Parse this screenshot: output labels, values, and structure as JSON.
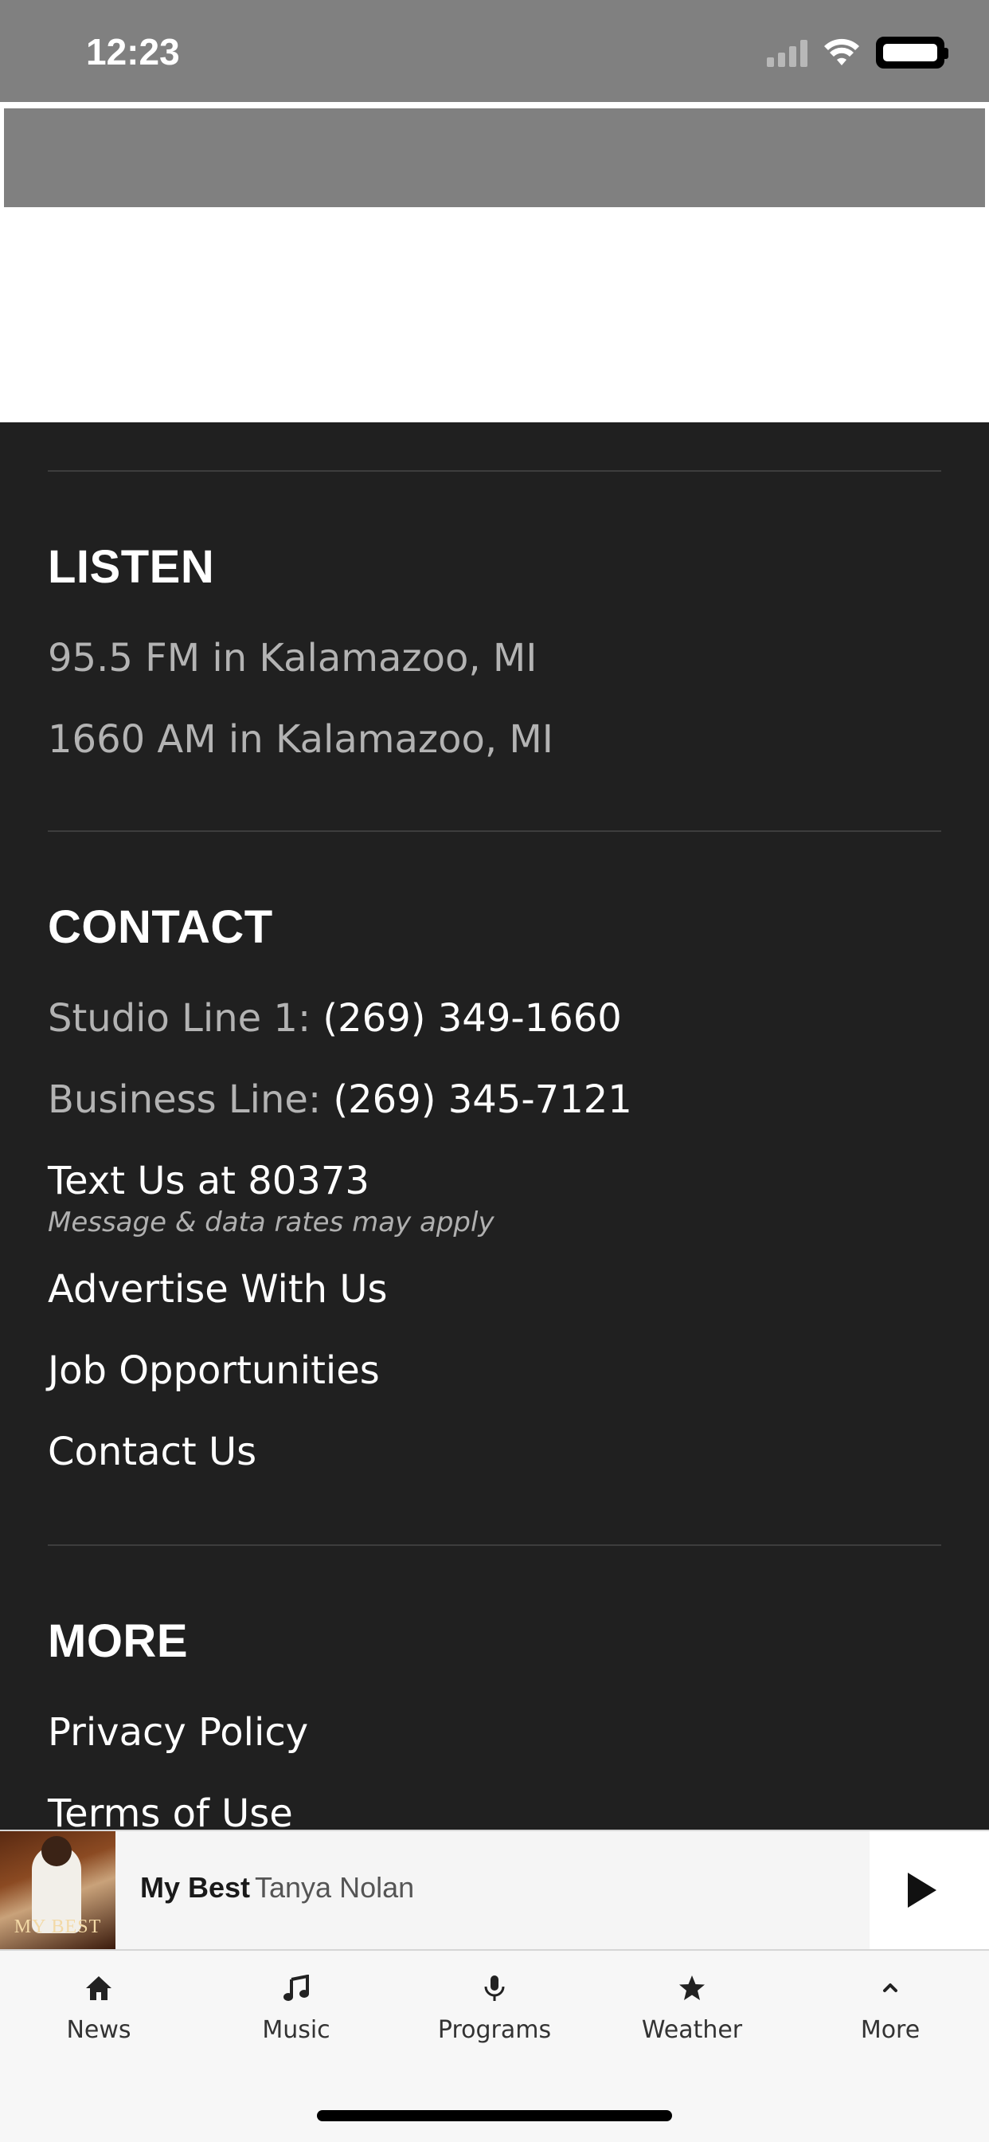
{
  "status_bar": {
    "time": "12:23"
  },
  "footer": {
    "listen": {
      "title": "LISTEN",
      "items": [
        "95.5 FM in Kalamazoo, MI",
        "1660 AM in Kalamazoo, MI"
      ]
    },
    "contact": {
      "title": "CONTACT",
      "studio_label": "Studio Line 1: ",
      "studio_phone": "(269) 349-1660",
      "business_label": "Business Line: ",
      "business_phone": "(269) 345-7121",
      "text_us": "Text Us at 80373",
      "text_note": "Message & data rates may apply",
      "advertise": "Advertise With Us",
      "jobs": "Job Opportunities",
      "contact_us": "Contact Us"
    },
    "more": {
      "title": "MORE",
      "privacy": "Privacy Policy",
      "terms": "Terms of Use"
    }
  },
  "player": {
    "track_title": "My Best",
    "artist": "Tanya Nolan",
    "album_art_text": "MY BEST"
  },
  "tabbar": {
    "tabs": [
      {
        "label": "News",
        "icon": "home-icon"
      },
      {
        "label": "Music",
        "icon": "music-note-icon"
      },
      {
        "label": "Programs",
        "icon": "microphone-icon"
      },
      {
        "label": "Weather",
        "icon": "star-icon"
      },
      {
        "label": "More",
        "icon": "chevron-up-icon"
      }
    ]
  }
}
